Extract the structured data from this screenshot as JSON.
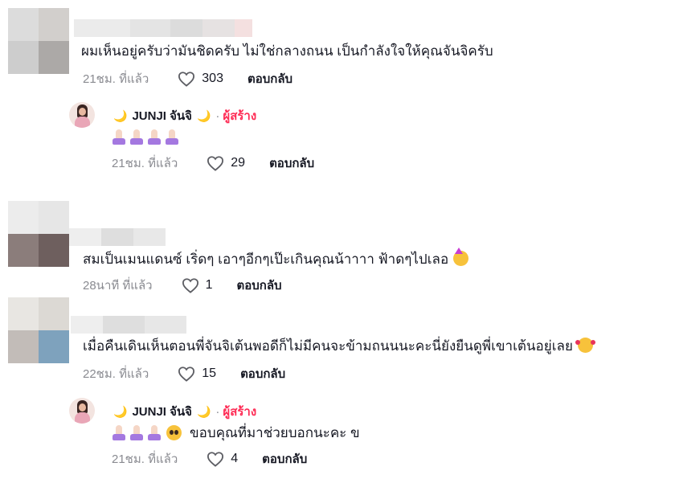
{
  "colors": {
    "text": "#161823",
    "muted": "#8a8b91",
    "creator_badge": "#fe2c55",
    "moon": "#e4b12b",
    "sleeve": "#a478e0"
  },
  "comments": [
    {
      "text": "ผมเห็นอยู่ครับว่ามันชิดครับ ไม่ใช่กลางถนน เป็นกำลังใจให้คุณจันจิครับ",
      "time": "21ชม. ที่แล้ว",
      "likes": "303",
      "reply_label": "ตอบกลับ"
    },
    {
      "text": "สมเป็นเมนแดนซ์ เริ่ดๆ เอาๆอีกๆเป๊ะเกินคุณน้าาาา ฟ้าดๆไปเลอ",
      "emoji": "partying-face",
      "time": "28นาที ที่แล้ว",
      "likes": "1",
      "reply_label": "ตอบกลับ"
    },
    {
      "text": "เมื่อคืนเดินเห็นตอนพี่จันจิเต้นพอดีก็ไม่มีคนจะข้ามถนนนะคะนี่ยังยืนดูพี่เขาเต้นอยู่เลย",
      "emoji": "smiling-face-with-hearts",
      "time": "22ชม. ที่แล้ว",
      "likes": "15",
      "reply_label": "ตอบกลับ"
    }
  ],
  "replies": [
    {
      "moon_left": "🌙",
      "username": "JUNJI จันจิ",
      "moon_right": "🌙",
      "separator": "·",
      "badge": "ผู้สร้าง",
      "palms_count": 4,
      "text": "",
      "time": "21ชม. ที่แล้ว",
      "likes": "29",
      "reply_label": "ตอบกลับ"
    },
    {
      "moon_left": "🌙",
      "username": "JUNJI จันจิ",
      "moon_right": "🌙",
      "separator": "·",
      "badge": "ผู้สร้าง",
      "palms_count": 3,
      "emoji": "pleading-face",
      "text": "ขอบคุณที่มาช่วยบอกนะคะ ข",
      "time": "21ชม. ที่แล้ว",
      "likes": "4",
      "reply_label": "ตอบกลับ"
    }
  ],
  "icons": {
    "like": "heart-outline-icon",
    "palms": "palms-up-together-icon"
  }
}
